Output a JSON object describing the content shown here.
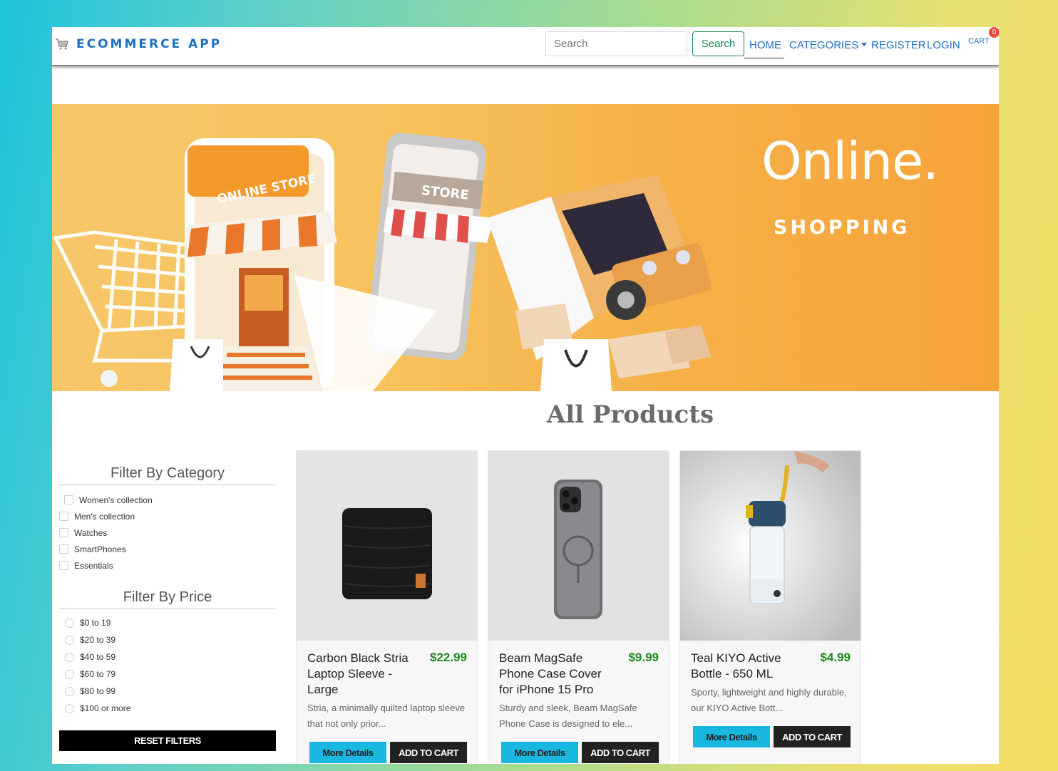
{
  "navbar": {
    "brand": "ECOMMERCE APP",
    "search_placeholder": "Search",
    "search_button": "Search",
    "links": {
      "home": "HOME",
      "categories": "CATEGORIES",
      "register": "REGISTER",
      "login": "LOGIN",
      "cart": "CART"
    },
    "cart_count": "0"
  },
  "banner": {
    "title": "Online.",
    "subtitle": "SHOPPING",
    "store_sign": "ONLINE STORE",
    "phone_sign": "STORE"
  },
  "main": {
    "heading": "All Products"
  },
  "sidebar": {
    "category_title": "Filter By Category",
    "categories": [
      "Women's collection",
      "Men's collection",
      "Watches",
      "SmartPhones",
      "Essentials"
    ],
    "price_title": "Filter By Price",
    "prices": [
      "$0 to 19",
      "$20 to 39",
      "$40 to 59",
      "$60 to 79",
      "$80 to 99",
      "$100 or more"
    ],
    "reset_button": "RESET FILTERS"
  },
  "products": [
    {
      "name": "Carbon Black Stria Laptop Sleeve - Large",
      "price": "$22.99",
      "description": "Stria, a minimally quilted laptop sleeve that not only prior...",
      "details_button": "More Details",
      "cart_button": "ADD TO CART"
    },
    {
      "name": "Beam MagSafe Phone Case Cover for iPhone 15 Pro",
      "price": "$9.99",
      "description": "Sturdy and sleek, Beam MagSafe Phone Case is designed to ele...",
      "details_button": "More Details",
      "cart_button": "ADD TO CART"
    },
    {
      "name": "Teal KIYO Active Bottle - 650 ML",
      "price": "$4.99",
      "description": "Sporty, lightweight and highly durable, our KIYO Active Bott...",
      "details_button": "More Details",
      "cart_button": "ADD TO CART"
    }
  ],
  "colors": {
    "brand": "#1e6fc4",
    "success": "#198754",
    "price": "#1e8a1e",
    "details_button": "#19b8e0",
    "badge": "#e74c3c"
  }
}
